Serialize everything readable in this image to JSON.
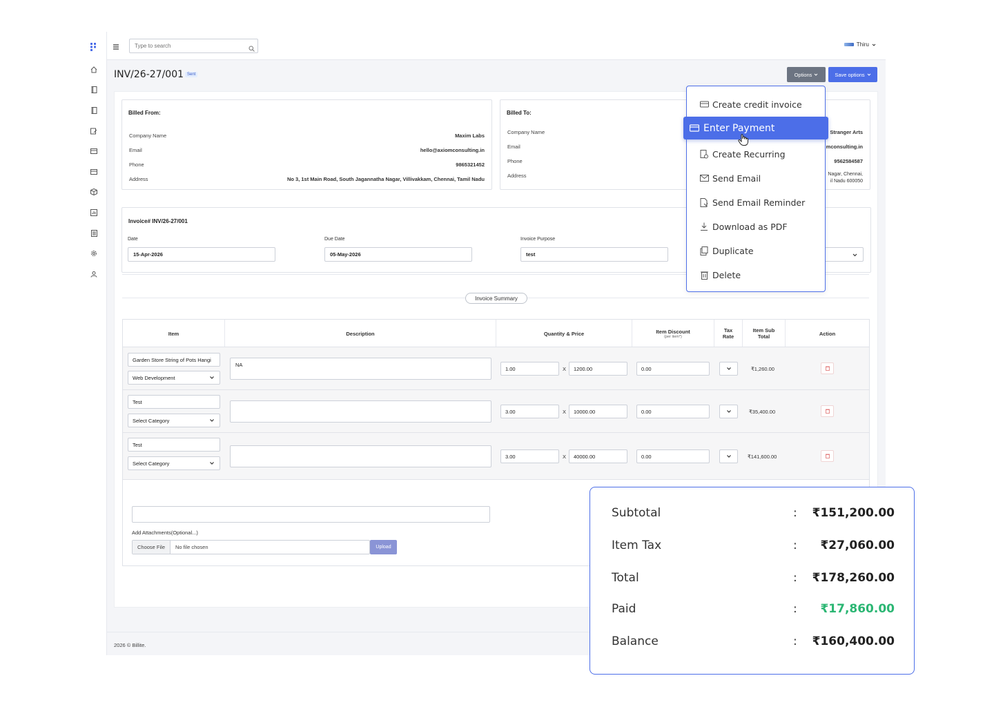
{
  "topbar": {
    "search_placeholder": "Type to search",
    "user_name": "Thiru"
  },
  "header": {
    "invoice_title": "INV/26-27/001",
    "status_badge": "Sent",
    "options_label": "Options",
    "save_options_label": "Save options"
  },
  "billed_from": {
    "title": "Billed From:",
    "company_label": "Company Name",
    "company": "Maxim Labs",
    "email_label": "Email",
    "email": "hello@axiomconsulting.in",
    "phone_label": "Phone",
    "phone": "9865321452",
    "address_label": "Address",
    "address": "No 3, 1st Main Road, South Jagannatha Nagar, Villivakkam, Chennai, Tamil Nadu"
  },
  "billed_to": {
    "title": "Billed To:",
    "company_label": "Company Name",
    "company": "Stranger Arts",
    "email_label": "Email",
    "email": "mconsulting.in",
    "phone_label": "Phone",
    "phone": "9562584587",
    "address_label": "Address",
    "address_line1": "Nagar, Chennai,",
    "address_line2": "il Nadu 600050"
  },
  "invoice_info": {
    "number_label": "Invoice# INV/26-27/001",
    "date_label": "Date",
    "date": "15-Apr-2026",
    "due_label": "Due Date",
    "due": "05-May-2026",
    "purpose_label": "Invoice Purpose",
    "purpose": "test"
  },
  "summary_pill": "Invoice Summary",
  "table": {
    "headers": {
      "item": "Item",
      "description": "Description",
      "qty_price": "Quantity & Price",
      "discount": "Item Discount",
      "discount_sub": "(per item*)",
      "tax_line1": "Tax",
      "tax_line2": "Rate",
      "subtotal_line1": "Item Sub",
      "subtotal_line2": "Total",
      "action": "Action"
    },
    "rows": [
      {
        "item": "Garden Store String of Pots Hangi",
        "category": "Web Development",
        "description": "NA",
        "qty": "1.00",
        "price": "1200.00",
        "discount": "0.00",
        "subtotal": "₹1,260.00"
      },
      {
        "item": "Test",
        "category": "Select Category",
        "description": "",
        "qty": "3.00",
        "price": "10000.00",
        "discount": "0.00",
        "subtotal": "₹35,400.00"
      },
      {
        "item": "Test",
        "category": "Select Category",
        "description": "",
        "qty": "3.00",
        "price": "40000.00",
        "discount": "0.00",
        "subtotal": "₹141,600.00"
      }
    ],
    "x_sign": "X"
  },
  "attachments": {
    "label": "Add Attachments(Optional...)",
    "choose": "Choose File",
    "none": "No file chosen",
    "upload": "Upload"
  },
  "footer": "2026 © Billite.",
  "options_menu": {
    "items": [
      {
        "label": "Create credit invoice",
        "icon": "credit-card-icon"
      },
      {
        "label": "Enter Payment",
        "icon": "payment-card-icon"
      },
      {
        "label": "Create Recurring",
        "icon": "recurring-icon"
      },
      {
        "label": "Send Email",
        "icon": "email-icon"
      },
      {
        "label": "Send Email Reminder",
        "icon": "reminder-icon"
      },
      {
        "label": "Download as PDF",
        "icon": "download-icon"
      },
      {
        "label": "Duplicate",
        "icon": "duplicate-icon"
      },
      {
        "label": "Delete",
        "icon": "trash-icon"
      }
    ]
  },
  "totals": {
    "subtotal_label": "Subtotal",
    "subtotal": "₹151,200.00",
    "tax_label": "Item Tax",
    "tax": "₹27,060.00",
    "total_label": "Total",
    "total": "₹178,260.00",
    "paid_label": "Paid",
    "paid": "₹17,860.00",
    "balance_label": "Balance",
    "balance": "₹160,400.00",
    "colon": ":"
  },
  "colors": {
    "accent": "#4c6ee8",
    "paid": "#2bb673",
    "danger": "#e07070"
  }
}
